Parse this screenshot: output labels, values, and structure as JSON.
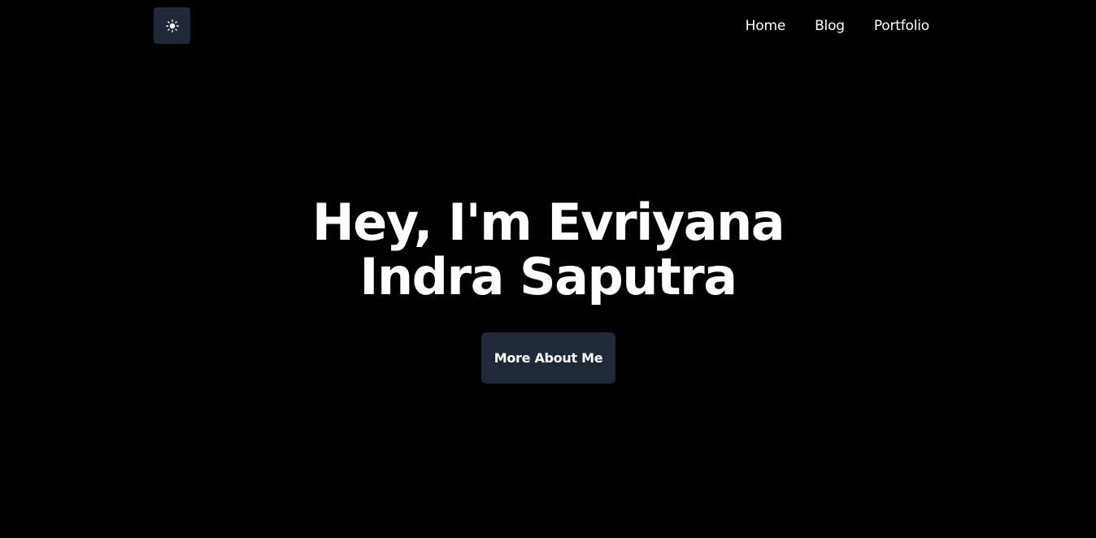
{
  "header": {
    "theme_toggle_icon": "sun-icon",
    "nav": [
      {
        "label": "Home"
      },
      {
        "label": "Blog"
      },
      {
        "label": "Portfolio"
      }
    ]
  },
  "hero": {
    "title": "Hey, I'm Evriyana Indra Saputra",
    "cta_label": "More About Me"
  },
  "colors": {
    "background": "#000000",
    "surface": "#1f2937",
    "text": "#ffffff"
  }
}
